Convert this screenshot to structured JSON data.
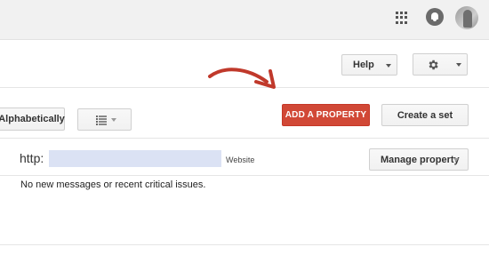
{
  "header": {
    "apps_icon": "apps-grid-icon",
    "notifications_icon": "bell-icon",
    "avatar": "user-avatar"
  },
  "toolbar": {
    "help_label": "Help",
    "settings_icon": "gear-icon"
  },
  "controls": {
    "sort_label": "Alphabetically",
    "view_icon": "list-view-icon",
    "add_property_label": "ADD A PROPERTY",
    "create_set_label": "Create a set"
  },
  "property": {
    "url_prefix": "http:",
    "type": "Website",
    "manage_label": "Manage property",
    "message": "No new messages or recent critical issues."
  },
  "colors": {
    "primary_red": "#d14836",
    "arrow_red": "#c0392b"
  }
}
